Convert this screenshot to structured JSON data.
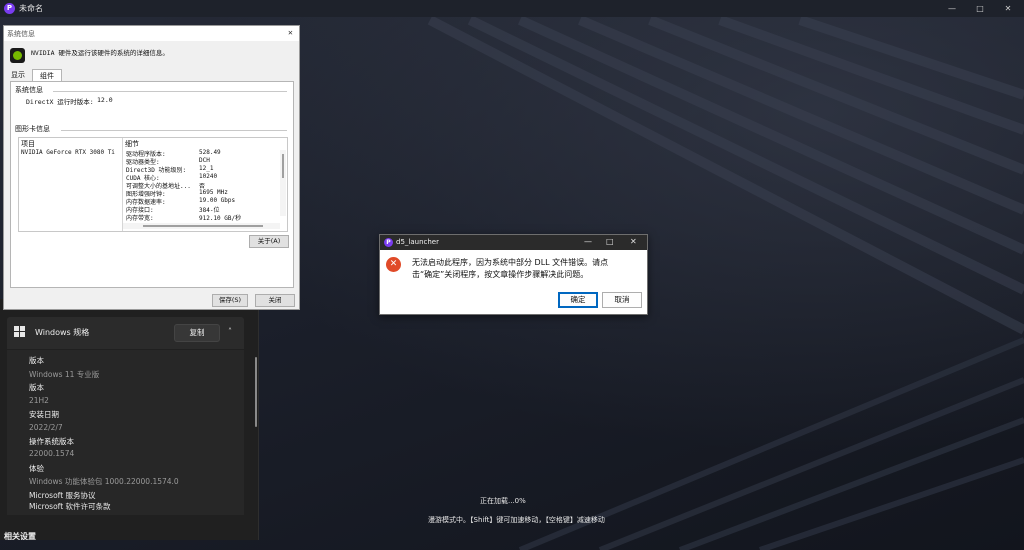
{
  "app": {
    "title": "未命名",
    "logo_letter": "P",
    "loading_text": "正在加载...0%",
    "navigation_hint": "漫游模式中。【Shift】键可加速移动，【空格键】减速移动",
    "window_controls": {
      "minimize": "—",
      "maximize": "□",
      "close": "✕"
    }
  },
  "settings": {
    "section_title": "Windows 规格",
    "copy_label": "复制",
    "chevron": "˄",
    "specs": [
      {
        "label": "版本",
        "value": "Windows 11 专业版"
      },
      {
        "label": "版本",
        "value": "21H2"
      },
      {
        "label": "安装日期",
        "value": "2022/2/7"
      },
      {
        "label": "操作系统版本",
        "value": "22000.1574"
      },
      {
        "label": "体验",
        "value": "Windows 功能体验包 1000.22000.1574.0"
      }
    ],
    "links": [
      "Microsoft 服务协议",
      "Microsoft 软件许可条款"
    ],
    "related_title": "相关设置"
  },
  "sysinfo": {
    "title": "系统信息",
    "close_glyph": "✕",
    "description": "NVIDIA 硬件及运行该硬件的系统的详细信息。",
    "tabs": [
      "显示",
      "组件"
    ],
    "system_group": "系统信息",
    "directx_label": "DirectX 运行时版本:",
    "directx_value": "12.0",
    "gfx_group": "图形卡信息",
    "col_item": "项目",
    "col_detail": "细节",
    "gpu_name": "NVIDIA GeForce RTX 3080 Ti",
    "details": [
      {
        "k": "驱动程序版本:",
        "v": "528.49"
      },
      {
        "k": "驱动器类型:",
        "v": "DCH"
      },
      {
        "k": "Direct3D 功能级别:",
        "v": "12_1"
      },
      {
        "k": "CUDA 核心:",
        "v": "10240"
      },
      {
        "k": "可调整大小的基地址...",
        "v": "否"
      },
      {
        "k": "图形增强时钟:",
        "v": "1695 MHz"
      },
      {
        "k": "内存数据速率:",
        "v": "19.00 Gbps"
      },
      {
        "k": "内存接口:",
        "v": "384-位"
      },
      {
        "k": "内存带宽:",
        "v": "912.10 GB/秒"
      }
    ],
    "about_label": "关于(A)",
    "save_label": "保存(S)",
    "close_label": "关闭"
  },
  "error_dialog": {
    "title": "d5_launcher",
    "logo_letter": "P",
    "icon_glyph": "✕",
    "message_line1": "无法启动此程序，因为系统中部分 DLL 文件错误。请点",
    "message_line2": "击“确定”关闭程序，按文章操作步骤解决此问题。",
    "ok_label": "确定",
    "cancel_label": "取消",
    "window_controls": {
      "minimize": "—",
      "maximize": "□",
      "close": "✕"
    }
  }
}
